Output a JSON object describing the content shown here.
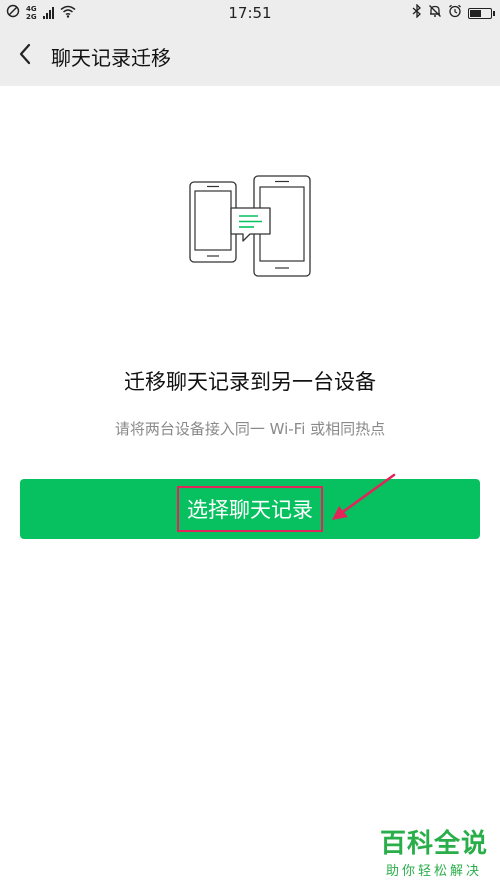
{
  "status_bar": {
    "network_top": "4G",
    "network_bottom": "2G",
    "time": "17:51"
  },
  "nav": {
    "title": "聊天记录迁移"
  },
  "main": {
    "heading": "迁移聊天记录到另一台设备",
    "subtitle": "请将两台设备接入同一 Wi-Fi 或相同热点",
    "button_label": "选择聊天记录"
  },
  "watermark": {
    "title": "百科全说",
    "subtitle": "助你轻松解决"
  },
  "colors": {
    "accent": "#07c160",
    "annotation": "#e2245a",
    "nav_background": "#ededed",
    "watermark": "#2aae4a"
  },
  "icons": {
    "back": "chevron-left-icon",
    "status_left": [
      "no-sim-icon",
      "signal-icon",
      "wifi-icon"
    ],
    "status_right": [
      "bluetooth-icon",
      "mute-bell-icon",
      "alarm-icon",
      "battery-icon"
    ],
    "illustration": "phone-transfer-icon"
  },
  "battery_level": 0.6
}
